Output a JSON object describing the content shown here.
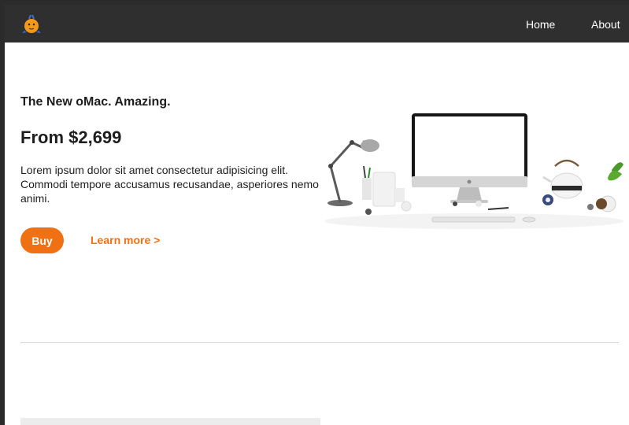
{
  "nav": {
    "logo_icon": "orange-bird-logo-icon",
    "home_label": "Home",
    "about_label": "About"
  },
  "hero": {
    "tagline": "The New oMac. Amazing.",
    "price": "From $2,699",
    "description": "Lorem ipsum dolor sit amet consectetur adipisicing elit. Commodi tempore accusamus recusandae, asperiores nemo animi.",
    "buy_label": "Buy",
    "learn_more_label": "Learn more >"
  },
  "colors": {
    "accent": "#f07114",
    "navbar": "#2f2f2f",
    "text": "#1e1e1e"
  }
}
